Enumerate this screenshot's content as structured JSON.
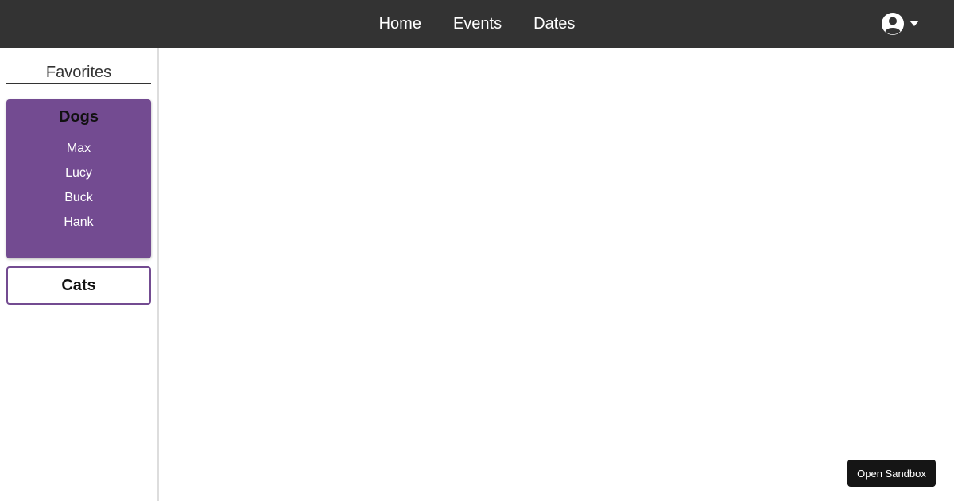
{
  "nav": {
    "links": [
      "Home",
      "Events",
      "Dates"
    ]
  },
  "account": {
    "icon": "user-circle-icon",
    "dropdown_icon": "caret-down-icon"
  },
  "sidebar": {
    "title": "Favorites",
    "groups": [
      {
        "label": "Dogs",
        "expanded": true,
        "items": [
          "Max",
          "Lucy",
          "Buck",
          "Hank"
        ]
      },
      {
        "label": "Cats",
        "expanded": false,
        "items": []
      }
    ]
  },
  "sandbox_button": {
    "label": "Open Sandbox"
  },
  "colors": {
    "topbar": "#333333",
    "accent": "#734b91",
    "sidebar_border": "#dddddd",
    "sandbox_button": "#151515"
  }
}
